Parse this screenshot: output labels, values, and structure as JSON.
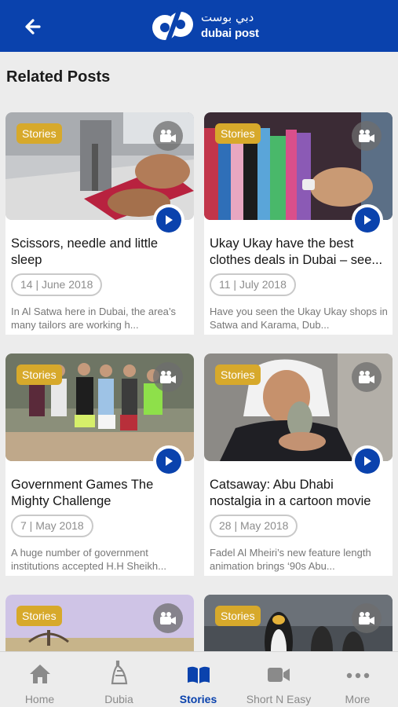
{
  "header": {
    "logo_ar": "دبي بوست",
    "logo_en": "dubai post",
    "brand_color": "#0a42ad"
  },
  "section_title": "Related Posts",
  "badge_color": "#d7a92b",
  "posts": [
    {
      "badge": "Stories",
      "title": "Scissors, needle and little sleep",
      "date": "14 | June 2018",
      "desc": "In Al Satwa here in Dubai, the area’s many tailors are working h..."
    },
    {
      "badge": "Stories",
      "title": "Ukay Ukay have the best clothes deals in Dubai – see...",
      "date": "11 | July 2018",
      "desc": "Have you seen the Ukay Ukay shops in Satwa and Karama, Dub..."
    },
    {
      "badge": "Stories",
      "title": "Government Games The Mighty Challenge",
      "date": "7 | May 2018",
      "desc": "A huge number of government institutions accepted H.H Sheikh..."
    },
    {
      "badge": "Stories",
      "title": "Catsaway: Abu Dhabi nostalgia in a cartoon movie",
      "date": "28 | May 2018",
      "desc": "Fadel Al Mheiri’s new feature length animation brings ‘90s Abu..."
    },
    {
      "badge": "Stories"
    },
    {
      "badge": "Stories"
    }
  ],
  "tabs": [
    {
      "label": "Home",
      "icon": "home-icon"
    },
    {
      "label": "Dubia",
      "icon": "burj-icon"
    },
    {
      "label": "Stories",
      "icon": "book-icon",
      "active": true
    },
    {
      "label": "Short N Easy",
      "icon": "video-icon"
    },
    {
      "label": "More",
      "icon": "more-icon"
    }
  ]
}
